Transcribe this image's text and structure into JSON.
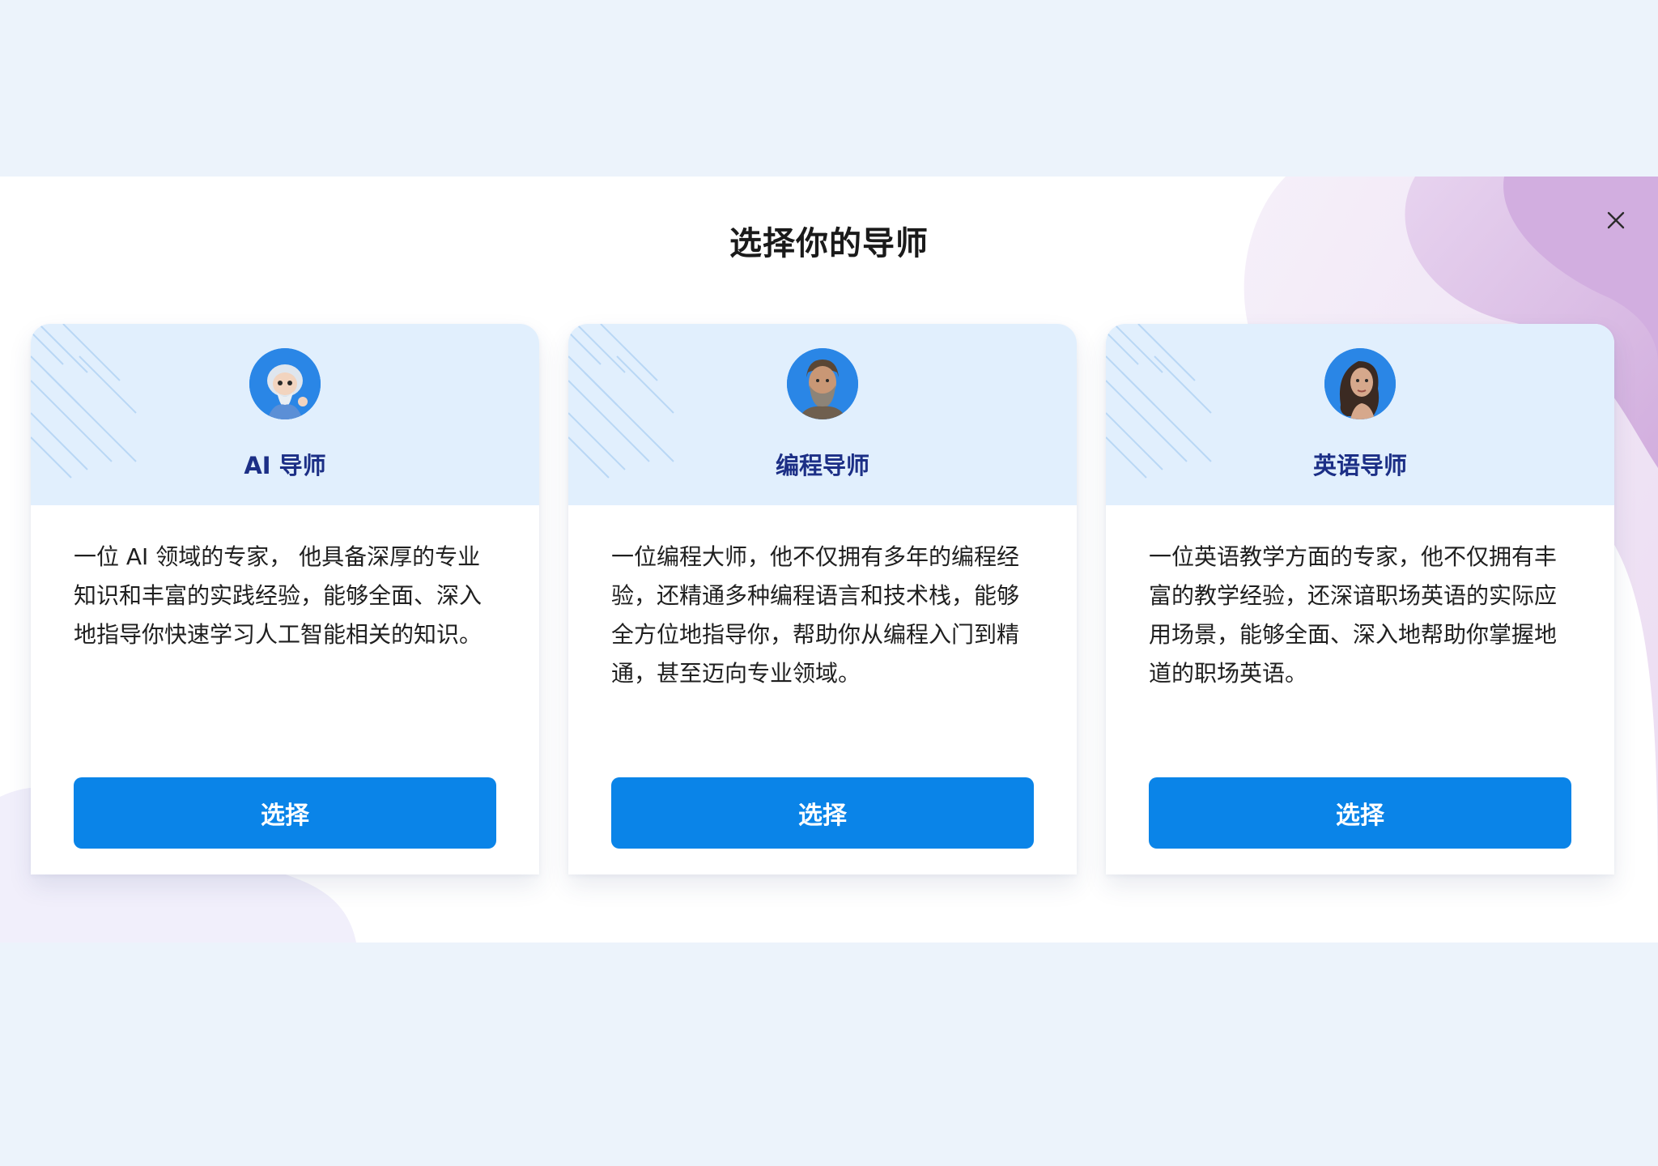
{
  "dialog": {
    "title": "选择你的导师",
    "close_icon": "close-icon"
  },
  "mentors": [
    {
      "name": "AI 导师",
      "avatar_icon": "cartoon-sage-avatar",
      "description": "一位 AI 领域的专家， 他具备深厚的专业知识和丰富的实践经验，能够全面、深入地指导你快速学习人工智能相关的知识。",
      "button_label": "选择"
    },
    {
      "name": "编程导师",
      "avatar_icon": "bearded-man-avatar",
      "description": "一位编程大师，他不仅拥有多年的编程经验，还精通多种编程语言和技术栈，能够全方位地指导你，帮助你从编程入门到精通，甚至迈向专业领域。",
      "button_label": "选择"
    },
    {
      "name": "英语导师",
      "avatar_icon": "woman-avatar",
      "description": "一位英语教学方面的专家，他不仅拥有丰富的教学经验，还深谙职场英语的实际应用场景，能够全面、深入地帮助你掌握地道的职场英语。",
      "button_label": "选择"
    }
  ],
  "colors": {
    "page_background": "#ecf3fb",
    "card_header": "#e1effd",
    "mentor_name": "#1c2f86",
    "button": "#0a84e8",
    "avatar_bg": "#2a86e6",
    "blob_purple": "#d9b9e3"
  }
}
